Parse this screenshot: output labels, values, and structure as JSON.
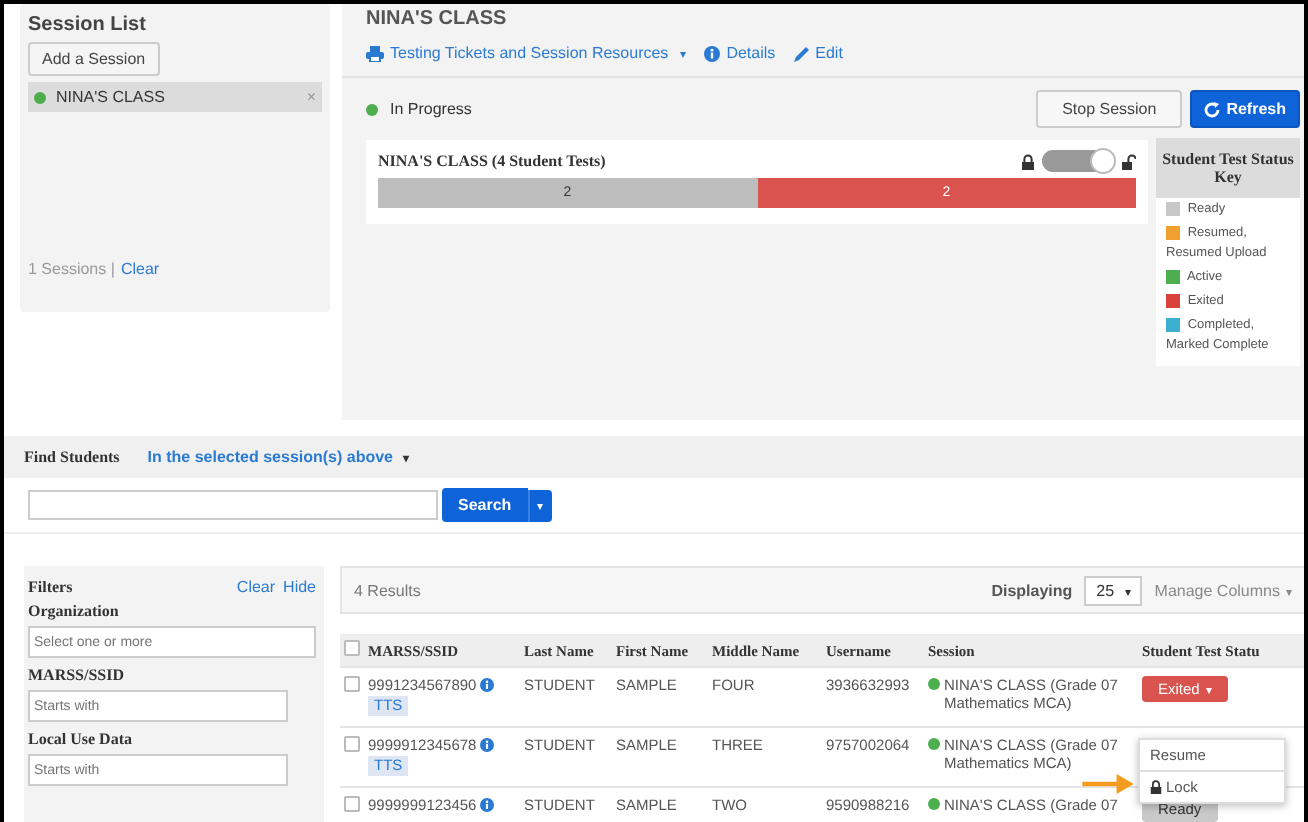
{
  "session_list": {
    "title": "Session List",
    "add_button": "Add a Session",
    "sessions": [
      {
        "name": "NINA'S CLASS",
        "color": "#4cae4c",
        "selected": true,
        "remove": "×"
      }
    ],
    "footer_count": "1 Sessions |",
    "footer_link": "Clear"
  },
  "session": {
    "title": "NINA'S CLASS",
    "links": [
      {
        "kind": "print",
        "label": "Testing Tickets and Session Resources",
        "caret": "▾"
      },
      {
        "kind": "info",
        "label": "Details"
      },
      {
        "kind": "edit",
        "label": "Edit"
      }
    ],
    "status": "In Progress",
    "stop_button": "Stop Session",
    "refresh_button": "Refresh",
    "card_title": "NINA'S CLASS (4 Student Tests)",
    "lock_toggle": {
      "on": true
    },
    "segments": [
      {
        "kind": "ready",
        "count": "2",
        "level": 0.5
      },
      {
        "kind": "exited",
        "count": "2",
        "level": 0.5
      }
    ],
    "key": {
      "title": "Student Test Status Key",
      "items": [
        {
          "color": "#c8c8c8",
          "label": "Ready"
        },
        {
          "color": "#f0a030",
          "label": "Resumed, Resumed Upload"
        },
        {
          "color": "#4cae4c",
          "label": "Active"
        },
        {
          "color": "#d9413a",
          "label": "Exited"
        },
        {
          "color": "#3aafd0",
          "label": "Completed, Marked Complete"
        }
      ]
    }
  },
  "find_students": {
    "label": "Find Students",
    "scope": "In the selected session(s) above",
    "scope_caret": "▾",
    "search_button": "Search",
    "search_caret": "▾"
  },
  "filters": {
    "title": "Filters",
    "clear": "Clear",
    "hide": "Hide",
    "groups": [
      {
        "label": "Organization",
        "placeholder": "Select one or more"
      },
      {
        "label": "MARSS/SSID",
        "placeholder": "Starts with"
      },
      {
        "label": "Local Use Data",
        "placeholder": "Starts with"
      }
    ]
  },
  "results": {
    "count": "4 Results",
    "displaying_label": "Displaying",
    "page_size": "25",
    "page_size_caret": "▾",
    "manage_columns": "Manage Columns",
    "manage_columns_caret": "▾",
    "all_checked": false,
    "columns": [
      "MARSS/SSID",
      "Last Name",
      "First Name",
      "Middle Name",
      "Username",
      "Session",
      "Student Test Statu"
    ],
    "rows": [
      {
        "checked": false,
        "marss": "9991234567890",
        "tts": "TTS",
        "last": "STUDENT",
        "first": "SAMPLE",
        "middle": "FOUR",
        "username": "3936632993",
        "session": "NINA'S CLASS (Grade 07 Mathematics MCA)",
        "status": {
          "kind": "exited",
          "label": "Exited",
          "caret": "▾"
        }
      },
      {
        "checked": false,
        "marss": "9999912345678",
        "tts": "TTS",
        "last": "STUDENT",
        "first": "SAMPLE",
        "middle": "THREE",
        "username": "9757002064",
        "session": "NINA'S CLASS (Grade 07 Mathematics MCA)"
      },
      {
        "checked": false,
        "marss": "9999999123456",
        "last": "STUDENT",
        "first": "SAMPLE",
        "middle": "TWO",
        "username": "9590988216",
        "session": "NINA'S CLASS (Grade 07",
        "status": {
          "kind": "ready",
          "label": "Ready"
        }
      }
    ],
    "menu": [
      {
        "kind": "plain",
        "label": "Resume"
      },
      {
        "kind": "lock",
        "label": "Lock"
      }
    ]
  }
}
